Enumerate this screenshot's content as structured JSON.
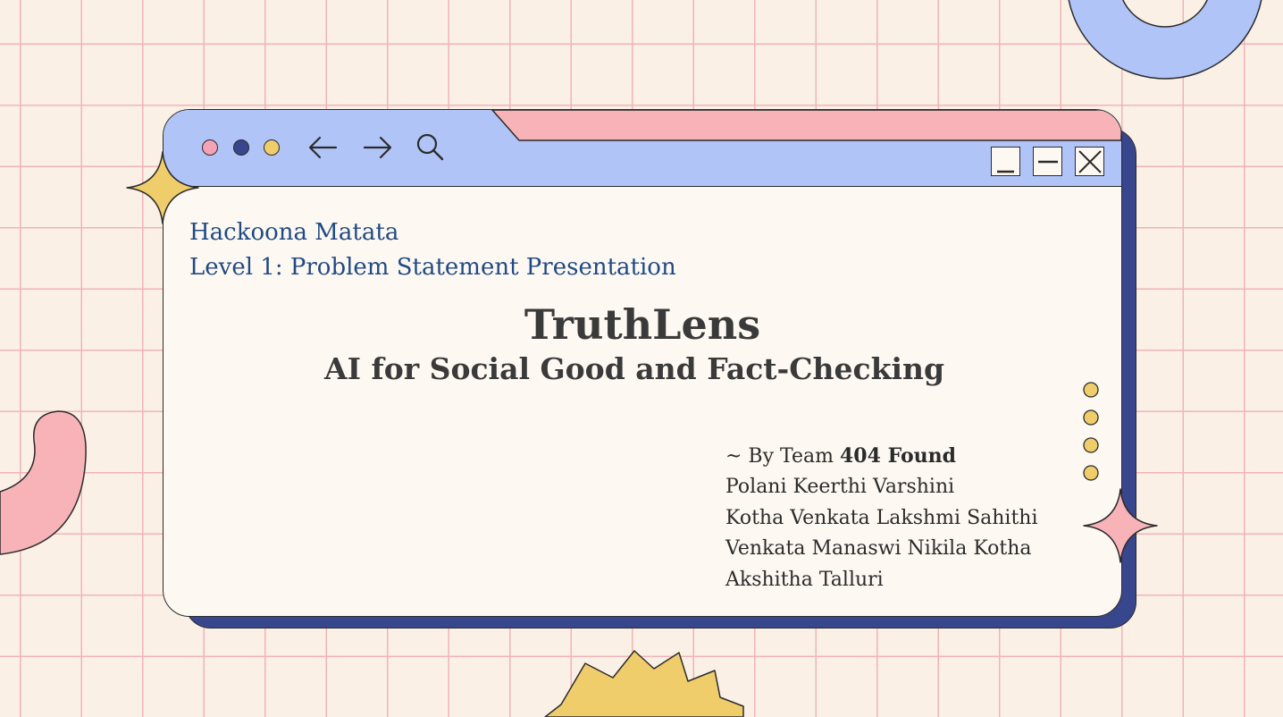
{
  "browser": {
    "back_icon": "arrow-left-icon",
    "forward_icon": "arrow-right-icon",
    "search_icon": "search-icon",
    "dot_colors": [
      "#f4a3b4",
      "#38468e",
      "#f0cd6b"
    ],
    "controls": [
      "minimize-icon",
      "restore-icon",
      "close-icon"
    ]
  },
  "event": {
    "name": "Hackoona Matata",
    "level": "Level 1: Problem Statement Presentation"
  },
  "project": {
    "title": "TruthLens",
    "subtitle": "AI for Social Good and Fact-Checking"
  },
  "team": {
    "prefix": "~ By Team ",
    "name": "404 Found",
    "members": [
      "Polani Keerthi Varshini",
      "Kotha Venkata Lakshmi Sahithi",
      "Venkata Manaswi Nikila Kotha",
      "Akshitha Talluri"
    ]
  },
  "colors": {
    "background": "#faf0e6",
    "grid": "#f2b3b8",
    "titlebar_blue": "#b0c4f7",
    "titlebar_pink": "#f7b3b8",
    "shadow_navy": "#38468e",
    "heading_blue": "#214a85",
    "star_yellow": "#f0cd6b",
    "star_pink": "#f7b3b8"
  }
}
